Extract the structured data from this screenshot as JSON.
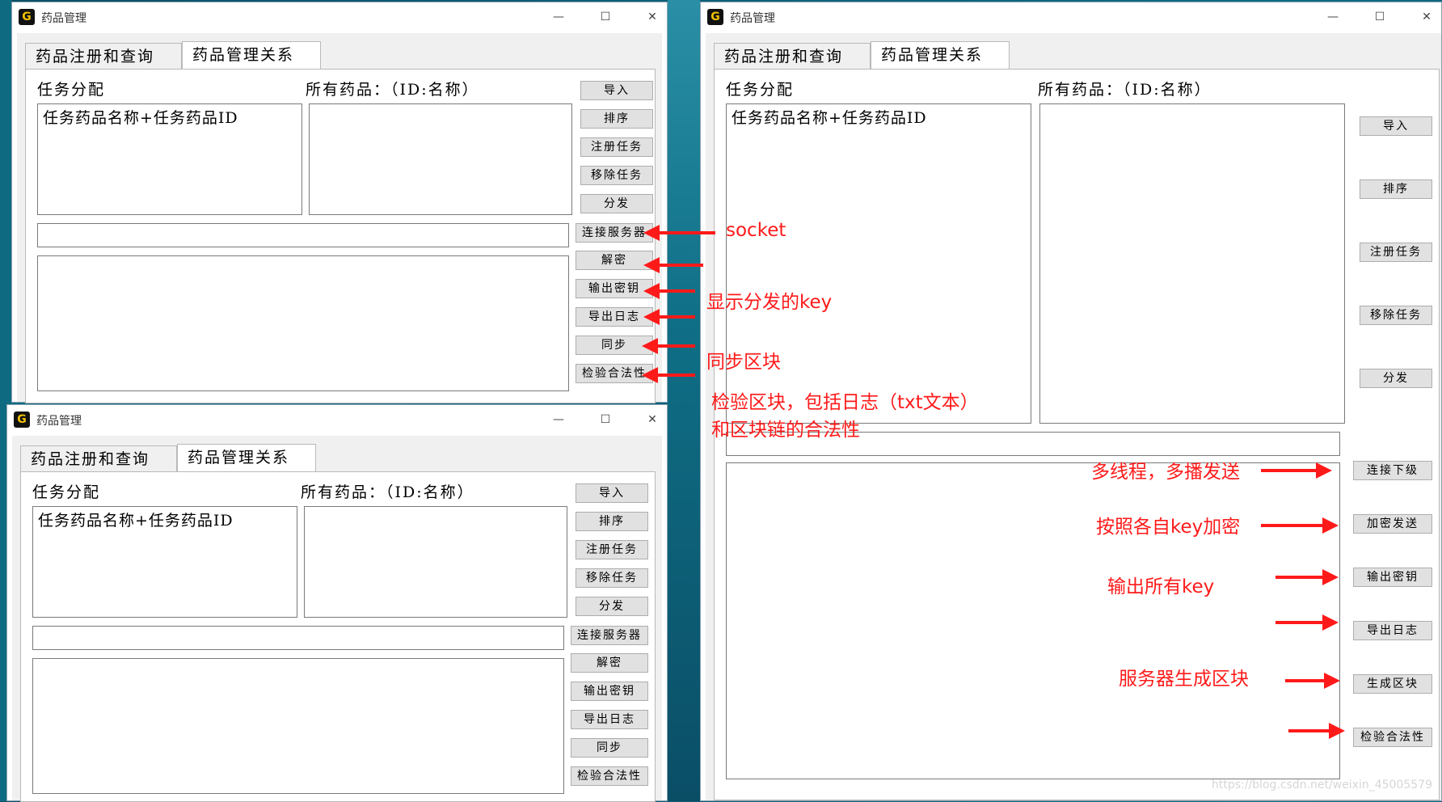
{
  "window_title": "药品管理",
  "app_icon_glyph": "G",
  "window_buttons": {
    "minimize": "—",
    "maximize": "☐",
    "close": "✕"
  },
  "tabs": [
    "药品注册和查询",
    "药品管理关系"
  ],
  "labels": {
    "task_assign": "任务分配",
    "all_drugs": "所有药品：（ID:名称）"
  },
  "task_list_item": "任务药品名称+任务药品ID",
  "client_buttons": [
    "导入",
    "排序",
    "注册任务",
    "移除任务",
    "分发",
    "连接服务器",
    "解密",
    "输出密钥",
    "导出日志",
    "同步",
    "检验合法性"
  ],
  "server_buttons": [
    "导入",
    "排序",
    "注册任务",
    "移除任务",
    "分发",
    "连接下级",
    "加密发送",
    "输出密钥",
    "导出日志",
    "生成区块",
    "检验合法性"
  ],
  "annotations": {
    "socket": "socket",
    "show_key": "显示分发的key",
    "sync_block": "同步区块",
    "verify_line1": "检验区块，包括日志（txt文本）",
    "verify_line2": "和区块链的合法性",
    "multithread": "多线程，多播发送",
    "encrypt": "按照各自key加密",
    "output_keys": "输出所有key",
    "gen_block": "服务器生成区块"
  },
  "annotation_color": "#ff1a1a",
  "watermark": "https://blog.csdn.net/weixin_45005579"
}
